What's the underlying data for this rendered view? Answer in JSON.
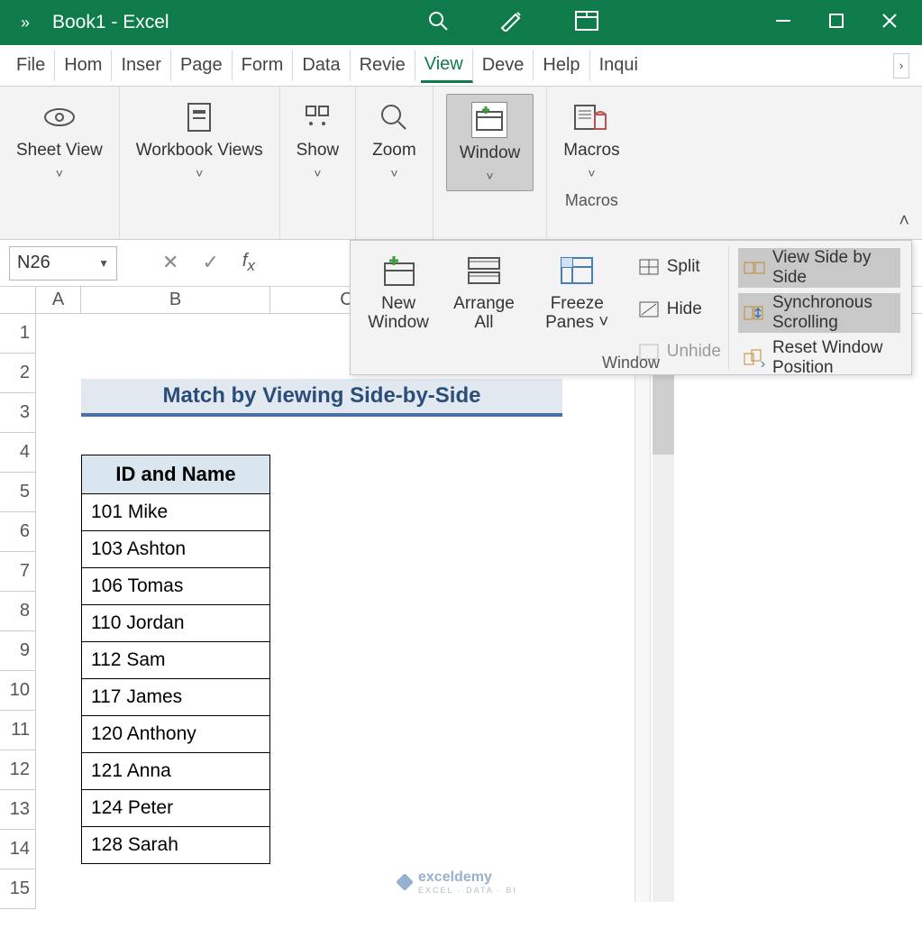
{
  "titlebar": {
    "title": "Book1  -  Excel"
  },
  "tabs": {
    "items": [
      "File",
      "Hom",
      "Inser",
      "Page",
      "Form",
      "Data",
      "Revie",
      "View",
      "Deve",
      "Help",
      "Inqui"
    ],
    "active_index": 7
  },
  "ribbon": {
    "sheet_view": "Sheet View",
    "workbook_views": "Workbook Views",
    "show": "Show",
    "zoom": "Zoom",
    "window": "Window",
    "macros": "Macros",
    "macros_group": "Macros"
  },
  "window_panel": {
    "new_window": "New Window",
    "arrange_all": "Arrange All",
    "freeze_panes": "Freeze Panes",
    "split": "Split",
    "hide": "Hide",
    "unhide": "Unhide",
    "view_side": "View Side by Side",
    "sync_scroll": "Synchronous Scrolling",
    "reset_pos": "Reset Window Position",
    "group_label": "Window"
  },
  "namebox": {
    "ref": "N26"
  },
  "columns": [
    "A",
    "B",
    "C"
  ],
  "row_numbers": [
    "1",
    "2",
    "3",
    "4",
    "5",
    "6",
    "7",
    "8",
    "9",
    "10",
    "11",
    "12",
    "13",
    "14",
    "15"
  ],
  "sheet": {
    "title": "Match by Viewing Side-by-Side",
    "table_header": "ID and Name",
    "rows": [
      "101 Mike",
      "103 Ashton",
      "106 Tomas",
      "110 Jordan",
      "112 Sam",
      "117 James",
      "120 Anthony",
      "121 Anna",
      "124 Peter",
      "128 Sarah"
    ]
  },
  "watermark": {
    "brand": "exceldemy",
    "tagline": "EXCEL · DATA · BI"
  }
}
